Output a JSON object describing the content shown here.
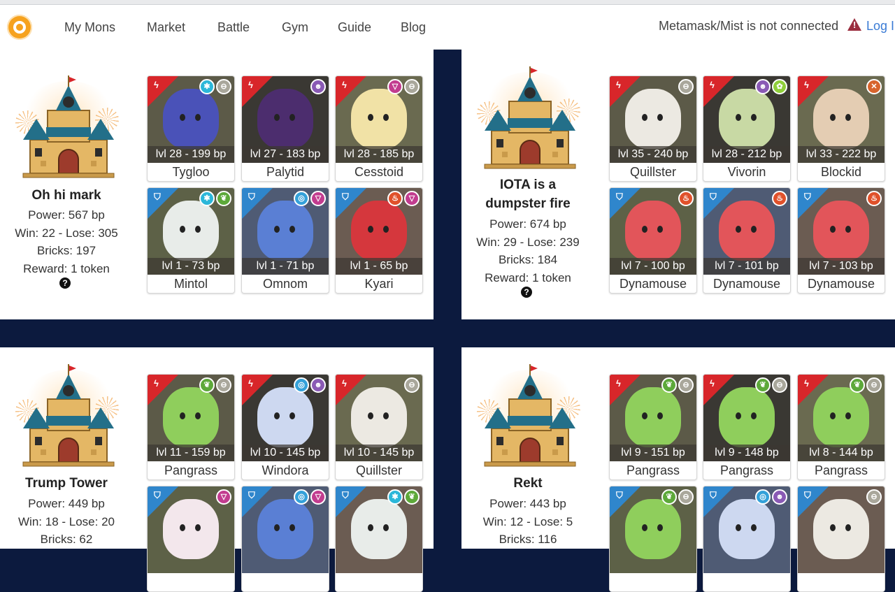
{
  "nav": {
    "items": [
      {
        "label": "My Mons"
      },
      {
        "label": "Market"
      },
      {
        "label": "Battle"
      },
      {
        "label": "Gym"
      },
      {
        "label": "Guide"
      },
      {
        "label": "Blog"
      }
    ],
    "status_text": "Metamask/Mist is not connected",
    "login_label": "Log In"
  },
  "gyms": [
    {
      "name": "Oh hi mark",
      "power": "Power: 567 bp",
      "record": "Win: 22 - Lose: 305",
      "bricks": "Bricks: 197",
      "reward": "Reward: 1 token",
      "help": "?",
      "mons": [
        {
          "level": "lvl 28 - 199 bp",
          "name": "Tygloo",
          "role": "attack",
          "elements": [
            "ice",
            "neutral"
          ],
          "art": "#4a52b8"
        },
        {
          "level": "lvl 27 - 183 bp",
          "name": "Palytid",
          "role": "attack",
          "elements": [
            "skull"
          ],
          "art": "#4c2d6e"
        },
        {
          "level": "lvl 28 - 185 bp",
          "name": "Cesstoid",
          "role": "attack",
          "elements": [
            "psychic",
            "neutral"
          ],
          "art": "#f1e2a6"
        },
        {
          "level": "lvl 1 - 73 bp",
          "name": "Mintol",
          "role": "defense",
          "elements": [
            "ice",
            "grass"
          ],
          "art": "#e8ece9"
        },
        {
          "level": "lvl 1 - 71 bp",
          "name": "Omnom",
          "role": "defense",
          "elements": [
            "water",
            "psychic"
          ],
          "art": "#5a7fd4"
        },
        {
          "level": "lvl 1 - 65 bp",
          "name": "Kyari",
          "role": "defense",
          "elements": [
            "fire",
            "psychic"
          ],
          "art": "#d5373d"
        }
      ]
    },
    {
      "name": "IOTA is a dumpster fire",
      "power": "Power: 674 bp",
      "record": "Win: 29 - Lose: 239",
      "bricks": "Bricks: 184",
      "reward": "Reward: 1 token",
      "help": "?",
      "mons": [
        {
          "level": "lvl 35 - 240 bp",
          "name": "Quillster",
          "role": "attack",
          "elements": [
            "neutral"
          ],
          "art": "#ece9e2"
        },
        {
          "level": "lvl 28 - 212 bp",
          "name": "Vivorin",
          "role": "attack",
          "elements": [
            "skull",
            "leaf"
          ],
          "art": "#c8d9a4"
        },
        {
          "level": "lvl 33 - 222 bp",
          "name": "Blockid",
          "role": "attack",
          "elements": [
            "fight"
          ],
          "art": "#e4cdb3"
        },
        {
          "level": "lvl 7 - 100 bp",
          "name": "Dynamouse",
          "role": "defense",
          "elements": [
            "fire"
          ],
          "art": "#e2555a"
        },
        {
          "level": "lvl 7 - 101 bp",
          "name": "Dynamouse",
          "role": "defense",
          "elements": [
            "fire"
          ],
          "art": "#e2555a"
        },
        {
          "level": "lvl 7 - 103 bp",
          "name": "Dynamouse",
          "role": "defense",
          "elements": [
            "fire"
          ],
          "art": "#e2555a"
        }
      ]
    },
    {
      "name": "Trump Tower",
      "power": "Power: 449 bp",
      "record": "Win: 18 - Lose: 20",
      "bricks": "Bricks: 62",
      "reward": "",
      "help": "",
      "mons": [
        {
          "level": "lvl 11 - 159 bp",
          "name": "Pangrass",
          "role": "attack",
          "elements": [
            "grass",
            "neutral"
          ],
          "art": "#8fce5c"
        },
        {
          "level": "lvl 10 - 145 bp",
          "name": "Windora",
          "role": "attack",
          "elements": [
            "water",
            "skull"
          ],
          "art": "#cdd8f0"
        },
        {
          "level": "lvl 10 - 145 bp",
          "name": "Quillster",
          "role": "attack",
          "elements": [
            "neutral"
          ],
          "art": "#ece9e2"
        },
        {
          "level": "",
          "name": "",
          "role": "defense",
          "elements": [
            "psychic"
          ],
          "art": "#f3e7ec"
        },
        {
          "level": "",
          "name": "",
          "role": "defense",
          "elements": [
            "water",
            "psychic"
          ],
          "art": "#5a7fd4"
        },
        {
          "level": "",
          "name": "",
          "role": "defense",
          "elements": [
            "ice",
            "grass"
          ],
          "art": "#e8ece9"
        }
      ]
    },
    {
      "name": "Rekt",
      "power": "Power: 443 bp",
      "record": "Win: 12 - Lose: 5",
      "bricks": "Bricks: 116",
      "reward": "",
      "help": "",
      "mons": [
        {
          "level": "lvl 9 - 151 bp",
          "name": "Pangrass",
          "role": "attack",
          "elements": [
            "grass",
            "neutral"
          ],
          "art": "#8fce5c"
        },
        {
          "level": "lvl 9 - 148 bp",
          "name": "Pangrass",
          "role": "attack",
          "elements": [
            "grass",
            "neutral"
          ],
          "art": "#8fce5c"
        },
        {
          "level": "lvl 8 - 144 bp",
          "name": "Pangrass",
          "role": "attack",
          "elements": [
            "grass",
            "neutral"
          ],
          "art": "#8fce5c"
        },
        {
          "level": "",
          "name": "",
          "role": "defense",
          "elements": [
            "grass",
            "neutral"
          ],
          "art": "#8fce5c"
        },
        {
          "level": "",
          "name": "",
          "role": "defense",
          "elements": [
            "water",
            "skull"
          ],
          "art": "#cdd8f0"
        },
        {
          "level": "",
          "name": "",
          "role": "defense",
          "elements": [
            "neutral"
          ],
          "art": "#ece9e2"
        }
      ]
    }
  ],
  "colors": {
    "attack": "#d8262a",
    "defense": "#2f86cc",
    "background": "#0c1a3e",
    "link": "#3a7bd5",
    "warning": "#9b2d3e"
  },
  "element_icons": {
    "ice": {
      "color": "#2bb7d9",
      "glyph": "✱"
    },
    "neutral": {
      "color": "#a9a79b",
      "glyph": "⊖"
    },
    "skull": {
      "color": "#8a5ab5",
      "glyph": "☻"
    },
    "psychic": {
      "color": "#c23c8f",
      "glyph": "▽"
    },
    "grass": {
      "color": "#5da93a",
      "glyph": "❦"
    },
    "leaf": {
      "color": "#8fcf3a",
      "glyph": "✿"
    },
    "water": {
      "color": "#34a1d9",
      "glyph": "◎"
    },
    "fire": {
      "color": "#e0512b",
      "glyph": "♨"
    },
    "fight": {
      "color": "#d8642c",
      "glyph": "✕"
    }
  }
}
